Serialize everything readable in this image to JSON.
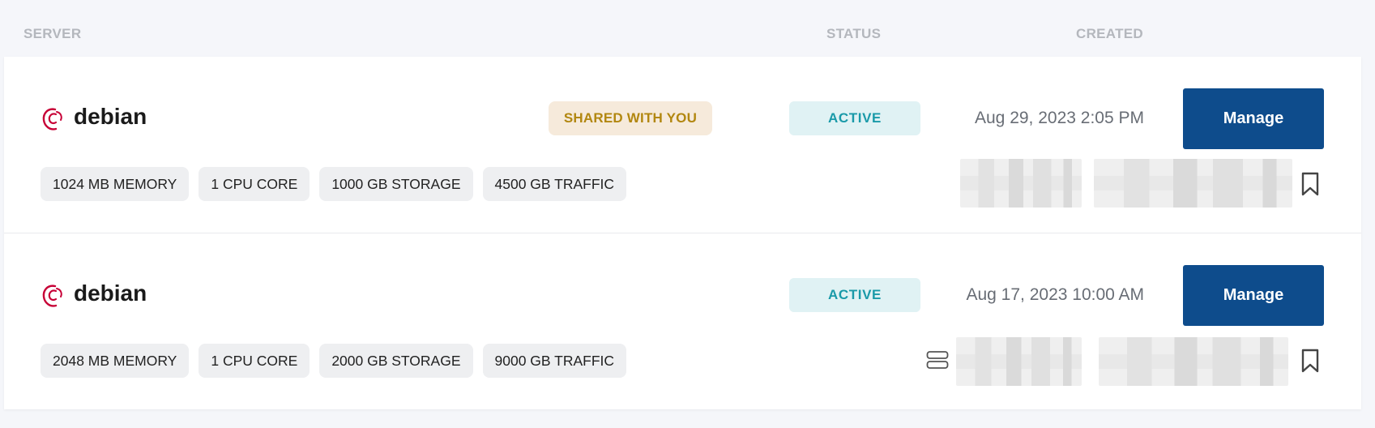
{
  "header": {
    "col_server": "SERVER",
    "col_status": "STATUS",
    "col_created": "CREATED"
  },
  "servers": [
    {
      "logo_icon": "debian-swirl-icon",
      "name": "debian",
      "shared_label": "SHARED WITH YOU",
      "status": "ACTIVE",
      "created": "Aug 29, 2023 2:05 PM",
      "manage_label": "Manage",
      "specs": [
        "1024 MB MEMORY",
        "1 CPU CORE",
        "1000 GB STORAGE",
        "4500 GB TRAFFIC"
      ],
      "bookmark_icon": "bookmark-icon"
    },
    {
      "logo_icon": "debian-swirl-icon",
      "name": "debian",
      "status": "ACTIVE",
      "created": "Aug 17, 2023 10:00 AM",
      "manage_label": "Manage",
      "specs": [
        "2048 MB MEMORY",
        "1 CPU CORE",
        "2000 GB STORAGE",
        "9000 GB TRAFFIC"
      ],
      "type_icon": "server-icon",
      "bookmark_icon": "bookmark-icon"
    }
  ],
  "colors": {
    "manage_button": "#0e4c8c",
    "status_bg": "#e0f2f4",
    "status_text": "#1a9aa9",
    "shared_bg": "#f6eadb",
    "shared_text": "#b28710",
    "debian_red": "#c70036"
  }
}
